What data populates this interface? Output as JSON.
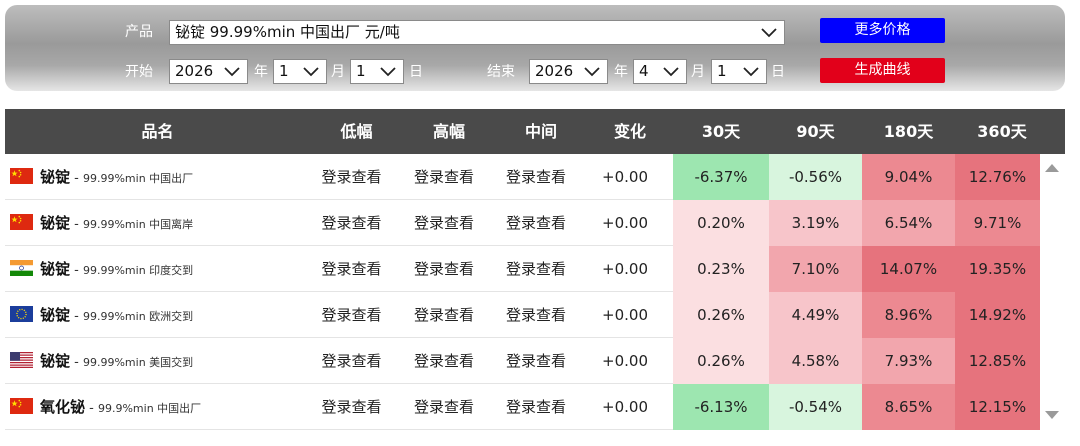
{
  "filter": {
    "product_label": "产品",
    "product_value": "铋锭 99.99%min 中国出厂 元/吨",
    "start_label": "开始",
    "end_label": "结束",
    "start": {
      "year": "2026",
      "year_unit": "年",
      "month": "1",
      "month_unit": "月",
      "day": "1",
      "day_unit": "日"
    },
    "end": {
      "year": "2026",
      "year_unit": "年",
      "month": "4",
      "month_unit": "月",
      "day": "1",
      "day_unit": "日"
    },
    "more_prices_button": "更多价格",
    "generate_chart_button": "生成曲线"
  },
  "table": {
    "headers": {
      "name": "品名",
      "low": "低幅",
      "high": "高幅",
      "mid": "中间",
      "change": "变化",
      "d30": "30天",
      "d90": "90天",
      "d180": "180天",
      "d360": "360天"
    },
    "rows": [
      {
        "flag": "china-flag-icon",
        "name": "铋锭",
        "spec": "99.99%min 中国出厂",
        "low": "登录查看",
        "high": "登录查看",
        "mid": "登录查看",
        "change": "+0.00",
        "d30": "-6.37%",
        "d90": "-0.56%",
        "d180": "9.04%",
        "d360": "12.76%"
      },
      {
        "flag": "china-flag-icon",
        "name": "铋锭",
        "spec": "99.99%min 中国离岸",
        "low": "登录查看",
        "high": "登录查看",
        "mid": "登录查看",
        "change": "+0.00",
        "d30": "0.20%",
        "d90": "3.19%",
        "d180": "6.54%",
        "d360": "9.71%"
      },
      {
        "flag": "india-flag-icon",
        "name": "铋锭",
        "spec": "99.99%min 印度交到",
        "low": "登录查看",
        "high": "登录查看",
        "mid": "登录查看",
        "change": "+0.00",
        "d30": "0.23%",
        "d90": "7.10%",
        "d180": "14.07%",
        "d360": "19.35%"
      },
      {
        "flag": "eu-flag-icon",
        "name": "铋锭",
        "spec": "99.99%min 欧洲交到",
        "low": "登录查看",
        "high": "登录查看",
        "mid": "登录查看",
        "change": "+0.00",
        "d30": "0.26%",
        "d90": "4.49%",
        "d180": "8.96%",
        "d360": "14.92%"
      },
      {
        "flag": "us-flag-icon",
        "name": "铋锭",
        "spec": "99.99%min 美国交到",
        "low": "登录查看",
        "high": "登录查看",
        "mid": "登录查看",
        "change": "+0.00",
        "d30": "0.26%",
        "d90": "4.58%",
        "d180": "7.93%",
        "d360": "12.85%"
      },
      {
        "flag": "china-flag-icon",
        "name": "氧化铋",
        "spec": "99.9%min 中国出厂",
        "low": "登录查看",
        "high": "登录查看",
        "mid": "登录查看",
        "change": "+0.00",
        "d30": "-6.13%",
        "d90": "-0.54%",
        "d180": "8.65%",
        "d360": "12.15%"
      }
    ]
  },
  "colors": {
    "panel": "#a8a8a8",
    "header": "#4a4a4a",
    "more_button": "#0000ff",
    "chart_button": "#e2001a",
    "negative_strong": "#9de6b0",
    "negative_weak": "#d8f5de",
    "positive_scale": [
      "#fbdfe1",
      "#f7c5ca",
      "#f2a6ad",
      "#ec8991",
      "#e6737d"
    ]
  }
}
